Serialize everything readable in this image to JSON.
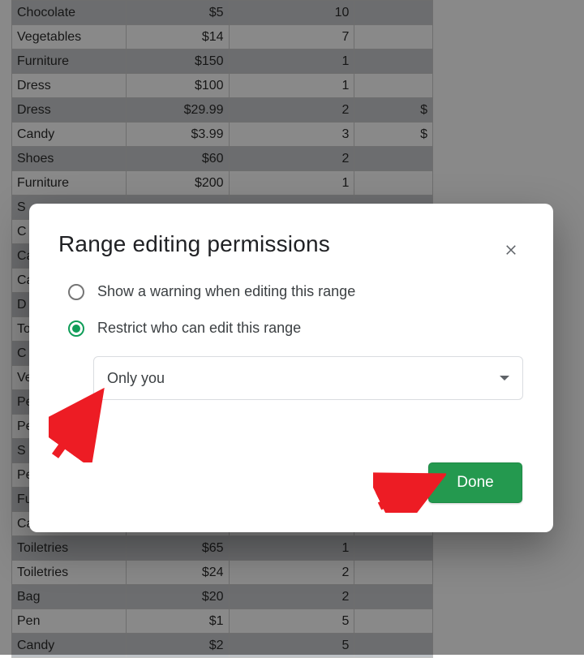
{
  "sheet": {
    "rows": [
      {
        "item": "Chocolate",
        "price": "$5",
        "qty": "10",
        "ext": ""
      },
      {
        "item": "Vegetables",
        "price": "$14",
        "qty": "7",
        "ext": ""
      },
      {
        "item": "Furniture",
        "price": "$150",
        "qty": "1",
        "ext": ""
      },
      {
        "item": "Dress",
        "price": "$100",
        "qty": "1",
        "ext": ""
      },
      {
        "item": "Dress",
        "price": "$29.99",
        "qty": "2",
        "ext": "$"
      },
      {
        "item": "Candy",
        "price": "$3.99",
        "qty": "3",
        "ext": "$"
      },
      {
        "item": "Shoes",
        "price": "$60",
        "qty": "2",
        "ext": ""
      },
      {
        "item": "Furniture",
        "price": "$200",
        "qty": "1",
        "ext": ""
      },
      {
        "item": "S",
        "price": "",
        "qty": "",
        "ext": ""
      },
      {
        "item": "C",
        "price": "",
        "qty": "",
        "ext": ""
      },
      {
        "item": "Ca",
        "price": "",
        "qty": "",
        "ext": ""
      },
      {
        "item": "Ca",
        "price": "",
        "qty": "",
        "ext": ""
      },
      {
        "item": "D",
        "price": "",
        "qty": "",
        "ext": ""
      },
      {
        "item": "To",
        "price": "",
        "qty": "",
        "ext": ""
      },
      {
        "item": "C",
        "price": "",
        "qty": "",
        "ext": ""
      },
      {
        "item": "Ve",
        "price": "",
        "qty": "",
        "ext": ""
      },
      {
        "item": "Pe",
        "price": "",
        "qty": "",
        "ext": ""
      },
      {
        "item": "Pe",
        "price": "",
        "qty": "",
        "ext": ""
      },
      {
        "item": "S",
        "price": "",
        "qty": "",
        "ext": ""
      },
      {
        "item": "Pe",
        "price": "",
        "qty": "",
        "ext": ""
      },
      {
        "item": "Fu",
        "price": "",
        "qty": "",
        "ext": ""
      },
      {
        "item": "Ca",
        "price": "",
        "qty": "",
        "ext": ""
      },
      {
        "item": "Toiletries",
        "price": "$65",
        "qty": "1",
        "ext": ""
      },
      {
        "item": "Toiletries",
        "price": "$24",
        "qty": "2",
        "ext": ""
      },
      {
        "item": "Bag",
        "price": "$20",
        "qty": "2",
        "ext": ""
      },
      {
        "item": "Pen",
        "price": "$1",
        "qty": "5",
        "ext": ""
      },
      {
        "item": "Candy",
        "price": "$2",
        "qty": "5",
        "ext": ""
      }
    ]
  },
  "dialog": {
    "title": "Range editing permissions",
    "option_warning": "Show a warning when editing this range",
    "option_restrict": "Restrict who can edit this range",
    "selected_option": "restrict",
    "dropdown_value": "Only you",
    "done_label": "Done"
  }
}
